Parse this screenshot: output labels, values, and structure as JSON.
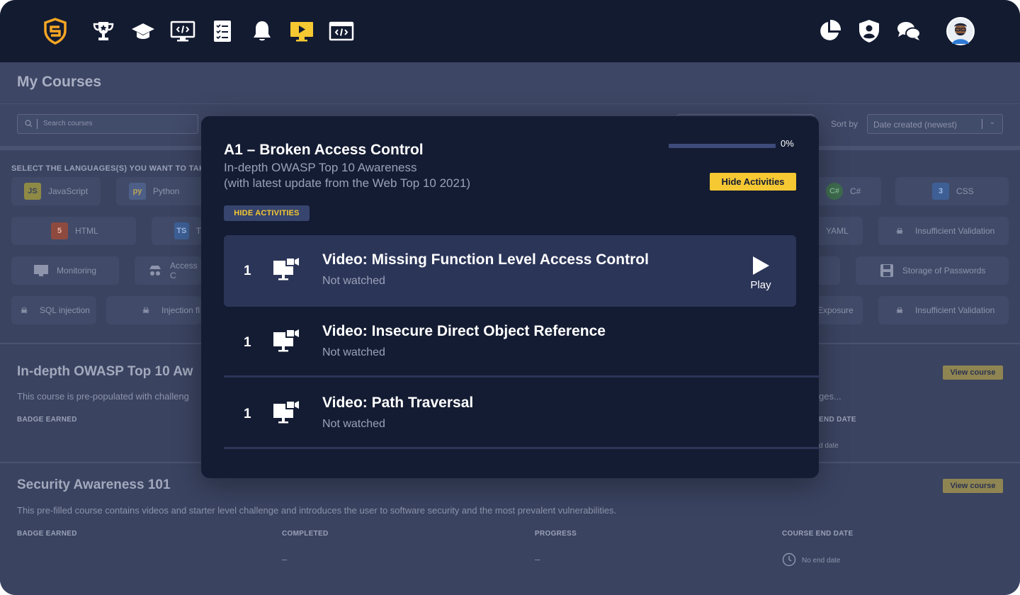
{
  "nav": {
    "icons": [
      "logo-shield-icon",
      "trophy-icon",
      "graduation-cap-icon",
      "code-monitor-icon",
      "checklist-icon",
      "bell-icon",
      "video-play-icon",
      "code-window-icon",
      "pie-chart-icon",
      "user-shield-icon",
      "chat-icon",
      "avatar"
    ],
    "active_icon": "video-play-icon",
    "accent": "#f6c832"
  },
  "page": {
    "title": "My Courses",
    "search_placeholder": "Search courses",
    "sort_label": "Sort by",
    "sort_value": "Date created (newest)",
    "languages_title": "SELECT THE LANGUAGES(S) YOU WANT TO TAKE",
    "languages": [
      {
        "label": "JavaScript",
        "icon": "JS"
      },
      {
        "label": "Python",
        "icon": "py"
      },
      {
        "label": "C#",
        "icon": "C#"
      },
      {
        "label": "CSS",
        "icon": "3"
      },
      {
        "label": "HTML",
        "icon": "5"
      },
      {
        "label": "T",
        "icon": "TS"
      },
      {
        "label": "YAML",
        "icon": ""
      },
      {
        "label": "Insufficient Validation",
        "icon": "skull"
      },
      {
        "label": "Monitoring",
        "icon": "monitor"
      },
      {
        "label": "Access C",
        "icon": "spy"
      },
      {
        "label": "Storage of Passwords",
        "icon": "floppy"
      },
      {
        "label": "SQL injection",
        "icon": "skull"
      },
      {
        "label": "Injection fl",
        "icon": "skull"
      },
      {
        "label": "Exposure",
        "icon": ""
      },
      {
        "label": "Insufficient Validation",
        "icon": "skull"
      }
    ]
  },
  "courses": [
    {
      "title": "In-depth OWASP Top 10 Aw",
      "description": "This course is pre-populated with challeng",
      "description_tail": "ges...",
      "view_label": "View course",
      "columns": {
        "badge": "BADGE EARNED",
        "end_date": "END DATE"
      },
      "end_date_value": "d date"
    },
    {
      "title": "Security Awareness 101",
      "description": "This pre-filled course contains videos and starter level challenge and introduces the user to software security and the most prevalent vulnerabilities.",
      "view_label": "View course",
      "columns": {
        "badge": "BADGE EARNED",
        "completed": "COMPLETED",
        "progress": "PROGRESS",
        "end_date": "COURSE END DATE"
      },
      "completed_value": "–",
      "progress_value": "–",
      "end_date_value": "No end date"
    }
  ],
  "modal": {
    "title": "A1 – Broken Access Control",
    "subtitle_line1": "In-depth OWASP Top 10 Awareness",
    "subtitle_line2": "(with latest update from the Web Top 10 2021)",
    "progress_value": 0,
    "progress_text": "0%",
    "hide_button": "Hide Activities",
    "hide_badge": "HIDE ACTIVITIES",
    "activities": [
      {
        "number": "1",
        "title": "Video: Missing Function Level Access Control",
        "status": "Not watched",
        "play_label": "Play"
      },
      {
        "number": "1",
        "title": "Video: Insecure Direct Object Reference",
        "status": "Not watched"
      },
      {
        "number": "1",
        "title": "Video: Path Traversal",
        "status": "Not watched"
      }
    ]
  }
}
